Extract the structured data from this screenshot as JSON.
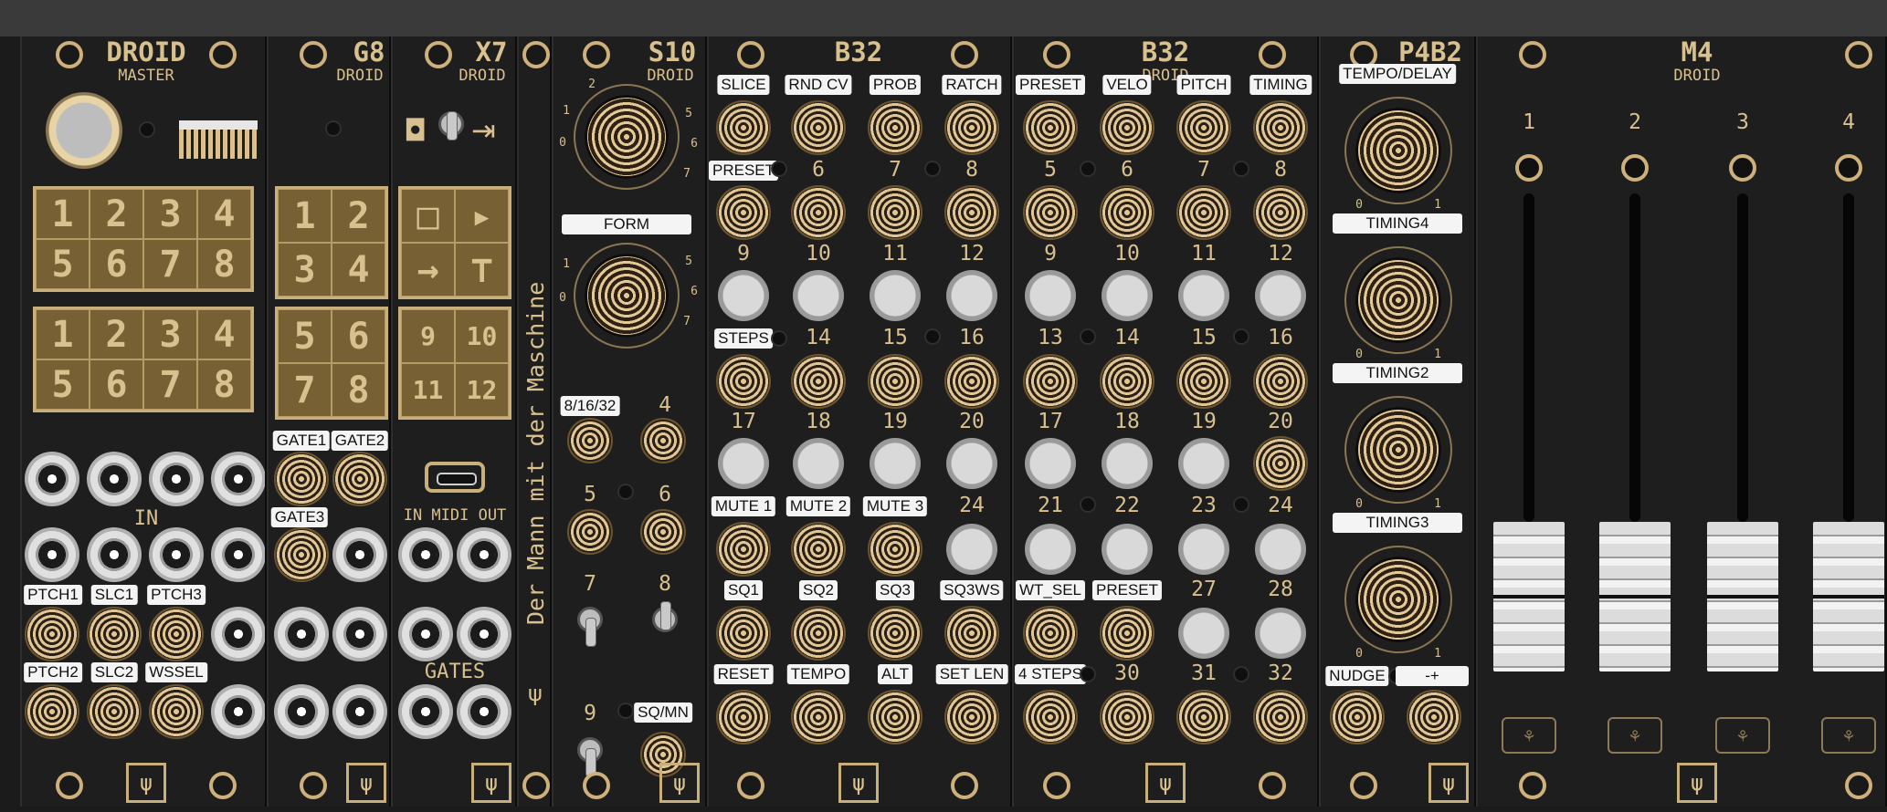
{
  "modules": {
    "master": {
      "title": "DROID",
      "sub": "MASTER",
      "grid_top": [
        "1",
        "2",
        "3",
        "4",
        "5",
        "6",
        "7",
        "8"
      ],
      "grid_bottom": [
        "1",
        "2",
        "3",
        "4",
        "5",
        "6",
        "7",
        "8"
      ],
      "in_label": "IN",
      "labels": {
        "ptch1": "PTCH1",
        "slc1": "SLC1",
        "ptch3": "PTCH3",
        "ptch2": "PTCH2",
        "slc2": "SLC2",
        "wssel": "WSSEL"
      },
      "logo": "ψ"
    },
    "g8": {
      "title": "G8",
      "sub": "DROID",
      "grid_a": [
        "1",
        "2",
        "3",
        "4"
      ],
      "grid_b": [
        "5",
        "6",
        "7",
        "8"
      ],
      "labels": {
        "gate1": "GATE1",
        "gate2": "GATE2",
        "gate3": "GATE3"
      },
      "logo": "ψ"
    },
    "x7": {
      "title": "X7",
      "sub": "DROID",
      "grid_a": [
        "□",
        "▸",
        "→",
        "⊤"
      ],
      "grid_b": [
        "9",
        "10",
        "11",
        "12"
      ],
      "midi_label": "IN MIDI OUT",
      "gates_label": "GATES",
      "logo": "ψ"
    },
    "blank": {
      "text": "Der Mann mit der Maschine",
      "glyph": "ψ"
    },
    "s10": {
      "title": "S10",
      "sub": "DROID",
      "form_label": "FORM",
      "knob_scale": [
        "1",
        "2",
        "5",
        "6",
        "7",
        "0"
      ],
      "form_scale": [
        "1",
        "5",
        "6",
        "7",
        "0"
      ],
      "labels": {
        "n81632": "8/16/32",
        "n4": "4",
        "n5": "5",
        "n6": "6",
        "n7": "7",
        "n8": "8",
        "n9": "9",
        "sqmn": "SQ/MN"
      },
      "logo": "ψ"
    },
    "b32a": {
      "title": "B32",
      "tags": {
        "t1": "SLICE",
        "t2": "RND CV",
        "t3": "PROB",
        "t4": "RATCH",
        "t5": "PRESET",
        "t13": "STEPS",
        "t21": "MUTE 1",
        "t22": "MUTE 2",
        "t23": "MUTE 3",
        "t25": "SQ1",
        "t26": "SQ2",
        "t27": "SQ3",
        "t28": "SQ3WS",
        "t29": "RESET",
        "t30": "TEMPO",
        "t31": "ALT",
        "t32": "SET LEN"
      },
      "nums": {
        "n6": "6",
        "n7": "7",
        "n8": "8",
        "n9": "9",
        "n10": "10",
        "n11": "11",
        "n12": "12",
        "n14": "14",
        "n15": "15",
        "n16": "16",
        "n17": "17",
        "n18": "18",
        "n19": "19",
        "n20": "20",
        "n24": "24"
      },
      "logo": "ψ"
    },
    "b32b": {
      "title": "B32",
      "sub": "DROID",
      "tags": {
        "t1": "PRESET",
        "t2": "VELO",
        "t3": "PITCH",
        "t4": "TIMING",
        "t25": "WT_SEL",
        "t26": "PRESET",
        "t29": "4 STEPS"
      },
      "nums": {
        "n5": "5",
        "n6": "6",
        "n7": "7",
        "n8": "8",
        "n9": "9",
        "n10": "10",
        "n11": "11",
        "n12": "12",
        "n13": "13",
        "n14": "14",
        "n15": "15",
        "n16": "16",
        "n17": "17",
        "n18": "18",
        "n19": "19",
        "n20": "20",
        "n21": "21",
        "n22": "22",
        "n23": "23",
        "n24": "24",
        "n27": "27",
        "n28": "28",
        "n30": "30",
        "n31": "31",
        "n32": "32"
      },
      "logo": "ψ"
    },
    "p4b2": {
      "title": "P4B2",
      "labels": {
        "k1": "TEMPO/DELAY",
        "k2": "TIMING4",
        "k3": "TIMING2",
        "k4": "TIMING3",
        "b1": "NUDGE",
        "b2": "-+"
      },
      "scale_min": "0",
      "scale_max": "1",
      "logo": "ψ"
    },
    "m4": {
      "title": "M4",
      "sub": "DROID",
      "channels": [
        "1",
        "2",
        "3",
        "4"
      ],
      "logo": "ψ"
    }
  },
  "colors": {
    "gold": "#d8c18f",
    "panel": "#1e1e1e",
    "rail": "#2b2b2b"
  }
}
